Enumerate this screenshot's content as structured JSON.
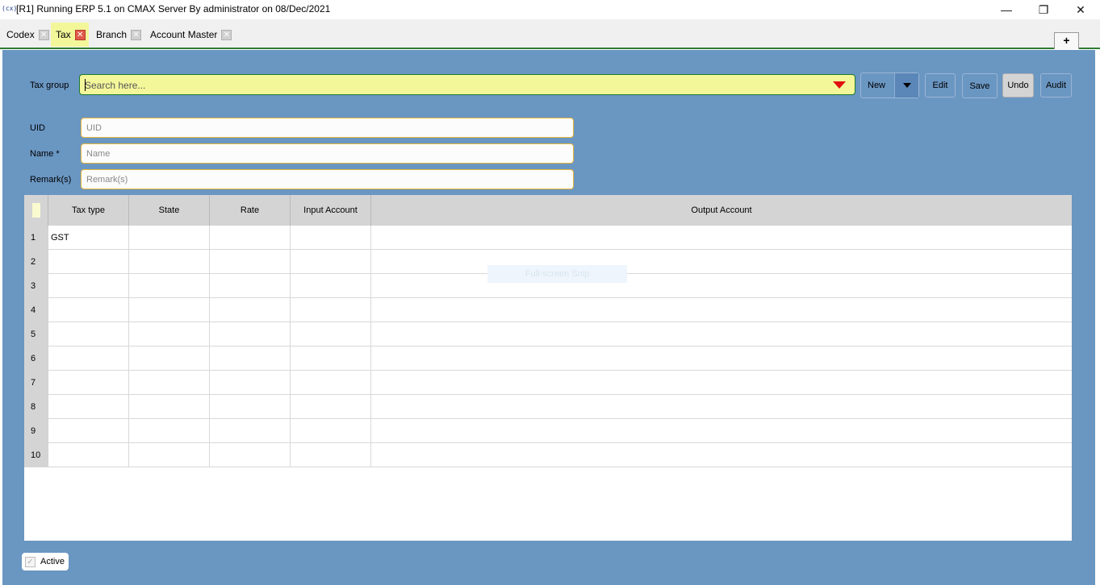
{
  "window": {
    "app_icon": "(cx)",
    "title": "[R1] Running ERP 5.1 on CMAX Server By administrator on 08/Dec/2021",
    "minimize": "—",
    "restore": "❐",
    "close": "✕"
  },
  "tabs": [
    {
      "label": "Codex",
      "close": "✕"
    },
    {
      "label": "Tax",
      "close": "✕",
      "active": true
    },
    {
      "label": "Branch",
      "close": "✕"
    },
    {
      "label": "Account Master",
      "close": "✕"
    }
  ],
  "tab_add": "+",
  "form": {
    "tax_group_label": "Tax group",
    "search_placeholder": "Search here...",
    "uid_label": "UID",
    "uid_placeholder": "UID",
    "name_label": "Name *",
    "name_placeholder": "Name",
    "remarks_label": "Remark(s)",
    "remarks_placeholder": "Remark(s)"
  },
  "toolbar": {
    "new": "New",
    "edit": "Edit",
    "save": "Save",
    "undo": "Undo",
    "audit": "Audit"
  },
  "grid": {
    "columns": [
      "Tax type",
      "State",
      "Rate",
      "Input Account",
      "Output Account"
    ],
    "rows": [
      {
        "num": "1",
        "tax_type": "GST",
        "state": "",
        "rate": "",
        "input_account": "",
        "output_account": ""
      },
      {
        "num": "2",
        "tax_type": "",
        "state": "",
        "rate": "",
        "input_account": "",
        "output_account": ""
      },
      {
        "num": "3",
        "tax_type": "",
        "state": "",
        "rate": "",
        "input_account": "",
        "output_account": ""
      },
      {
        "num": "4",
        "tax_type": "",
        "state": "",
        "rate": "",
        "input_account": "",
        "output_account": ""
      },
      {
        "num": "5",
        "tax_type": "",
        "state": "",
        "rate": "",
        "input_account": "",
        "output_account": ""
      },
      {
        "num": "6",
        "tax_type": "",
        "state": "",
        "rate": "",
        "input_account": "",
        "output_account": ""
      },
      {
        "num": "7",
        "tax_type": "",
        "state": "",
        "rate": "",
        "input_account": "",
        "output_account": ""
      },
      {
        "num": "8",
        "tax_type": "",
        "state": "",
        "rate": "",
        "input_account": "",
        "output_account": ""
      },
      {
        "num": "9",
        "tax_type": "",
        "state": "",
        "rate": "",
        "input_account": "",
        "output_account": ""
      },
      {
        "num": "10",
        "tax_type": "",
        "state": "",
        "rate": "",
        "input_account": "",
        "output_account": ""
      }
    ]
  },
  "overlay_text": "Full-screen Snip",
  "footer": {
    "active_label": "Active",
    "active_check": "✓"
  },
  "colors": {
    "panel": "#6a96c2",
    "search_bg": "#f3f79a",
    "field_border": "#e7b63c",
    "tab_active": "#f3f79a",
    "tab_close_active": "#e05a4a",
    "accent_line": "#2e7d32",
    "dropdown_arrow": "#e01010"
  },
  "icons": {
    "app": "app-logo-icon",
    "tab_close": "close-icon",
    "dropdown": "triangle-down-icon",
    "checkbox": "check-icon"
  }
}
